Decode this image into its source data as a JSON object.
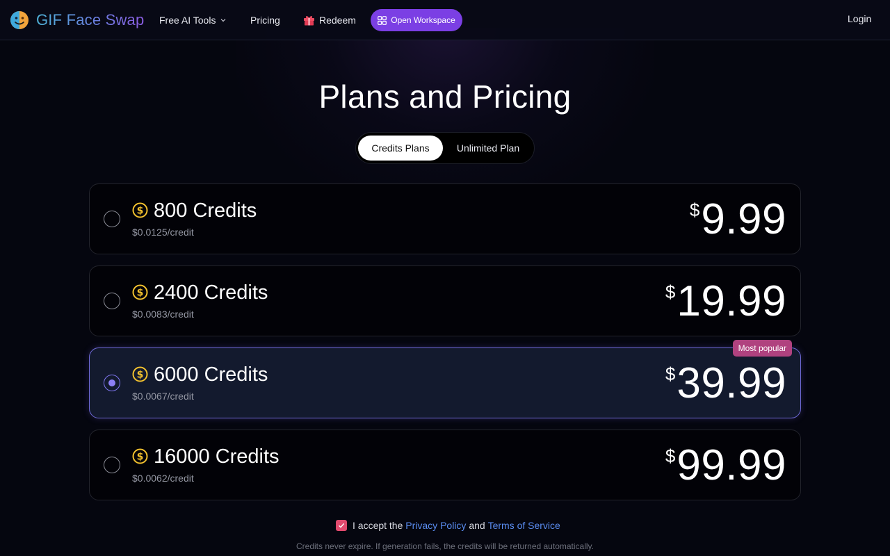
{
  "header": {
    "brand": "GIF Face Swap",
    "nav": {
      "free_tools": "Free AI Tools",
      "pricing": "Pricing",
      "redeem": "Redeem"
    },
    "workspace_button": "Open Workspace",
    "login": "Login"
  },
  "page": {
    "title": "Plans and Pricing",
    "tabs": [
      "Credits Plans",
      "Unlimited Plan"
    ],
    "active_tab": "Credits Plans"
  },
  "plans": [
    {
      "credits": "800 Credits",
      "rate": "$0.0125/credit",
      "currency": "$",
      "price": "9.99",
      "selected": false
    },
    {
      "credits": "2400 Credits",
      "rate": "$0.0083/credit",
      "currency": "$",
      "price": "19.99",
      "selected": false
    },
    {
      "credits": "6000 Credits",
      "rate": "$0.0067/credit",
      "currency": "$",
      "price": "39.99",
      "selected": true,
      "badge": "Most popular"
    },
    {
      "credits": "16000 Credits",
      "rate": "$0.0062/credit",
      "currency": "$",
      "price": "99.99",
      "selected": false
    }
  ],
  "terms": {
    "checked": true,
    "prefix": "I accept the",
    "privacy_link": "Privacy Policy",
    "and": "and",
    "tos_link": "Terms of Service"
  },
  "footnote": "Credits never expire. If generation fails, the credits will be returned automatically.",
  "colors": {
    "background": "#05060f",
    "accent_purple": "#7b3fe4",
    "selected_border": "#6f6ad8",
    "badge": "#b0427f",
    "link": "#5a8cf0",
    "coin": "#f2c12e"
  }
}
